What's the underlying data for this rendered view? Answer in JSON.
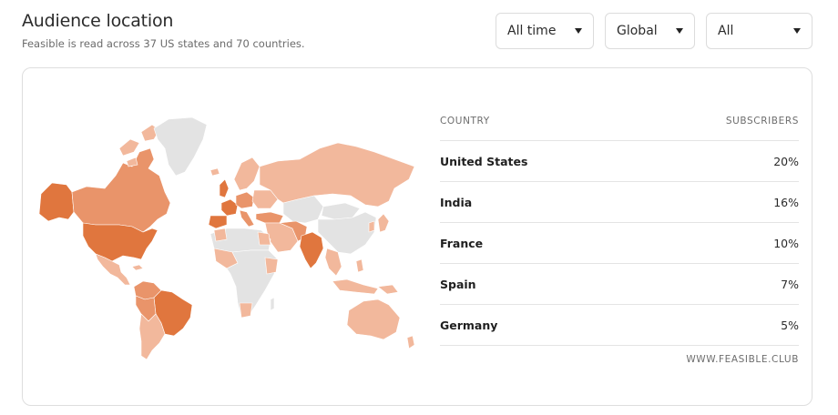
{
  "header": {
    "title": "Audience location",
    "subtitle": "Feasible is read across 37 US states and 70 countries."
  },
  "filters": {
    "time": "All time",
    "region": "Global",
    "segment": "All"
  },
  "map": {
    "colors": {
      "level_high": "#e0763e",
      "level_mid": "#e9946a",
      "level_low": "#f2b89c",
      "no_data": "#e3e3e3"
    }
  },
  "table": {
    "col_country": "COUNTRY",
    "col_subscribers": "SUBSCRIBERS",
    "rows": [
      {
        "country": "United States",
        "share": "20%"
      },
      {
        "country": "India",
        "share": "16%"
      },
      {
        "country": "France",
        "share": "10%"
      },
      {
        "country": "Spain",
        "share": "7%"
      },
      {
        "country": "Germany",
        "share": "5%"
      }
    ],
    "source": "WWW.FEASIBLE.CLUB"
  }
}
